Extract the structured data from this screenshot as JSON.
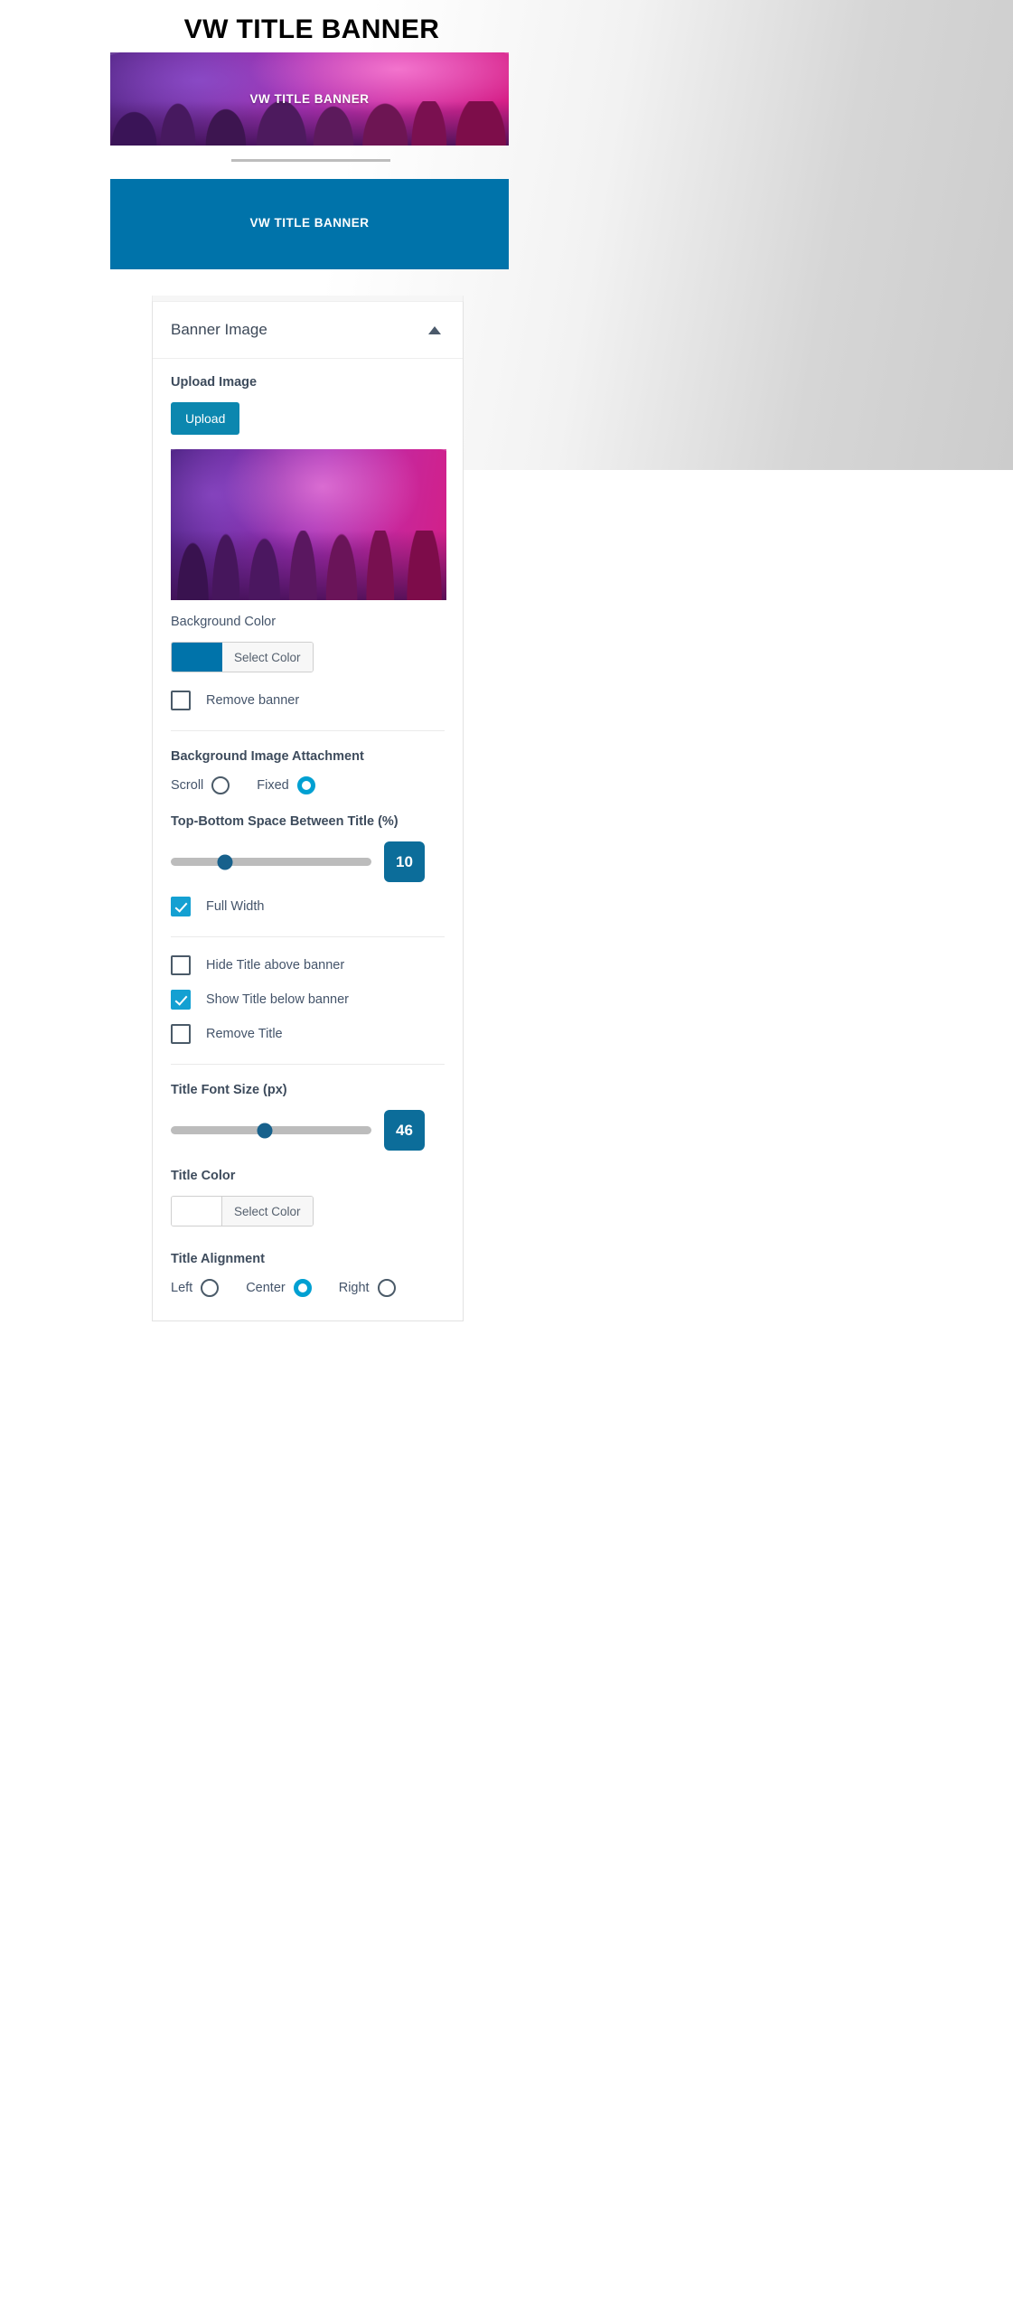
{
  "preview": {
    "page_title": "VW TITLE BANNER",
    "photo_banner_title": "VW TITLE BANNER",
    "blue_banner_title": "VW TITLE BANNER",
    "blue_banner_color": "#0073aa"
  },
  "panel": {
    "header_title": "Banner Image",
    "collapse_icon": "chevron-up-icon",
    "upload": {
      "label": "Upload Image",
      "button_label": "Upload"
    },
    "background_color": {
      "label": "Background Color",
      "select_label": "Select Color",
      "value": "#0073aa"
    },
    "remove_banner": {
      "label": "Remove banner",
      "checked": false
    },
    "attachment": {
      "label": "Background Image Attachment",
      "options": [
        {
          "label": "Scroll",
          "selected": false
        },
        {
          "label": "Fixed",
          "selected": true
        }
      ]
    },
    "top_bottom_space": {
      "label": "Top-Bottom Space Between Title (%)",
      "value": "10",
      "percent": 27
    },
    "full_width": {
      "label": "Full Width",
      "checked": true
    },
    "title_visibility": [
      {
        "label": "Hide Title above banner",
        "checked": false
      },
      {
        "label": "Show Title below banner",
        "checked": true
      },
      {
        "label": "Remove Title",
        "checked": false
      }
    ],
    "title_font_size": {
      "label": "Title Font Size (px)",
      "value": "46",
      "percent": 47
    },
    "title_color": {
      "label": "Title Color",
      "select_label": "Select Color",
      "value": "#ffffff"
    },
    "title_alignment": {
      "label": "Title Alignment",
      "options": [
        {
          "label": "Left",
          "selected": false
        },
        {
          "label": "Center",
          "selected": true
        },
        {
          "label": "Right",
          "selected": false
        }
      ]
    }
  }
}
